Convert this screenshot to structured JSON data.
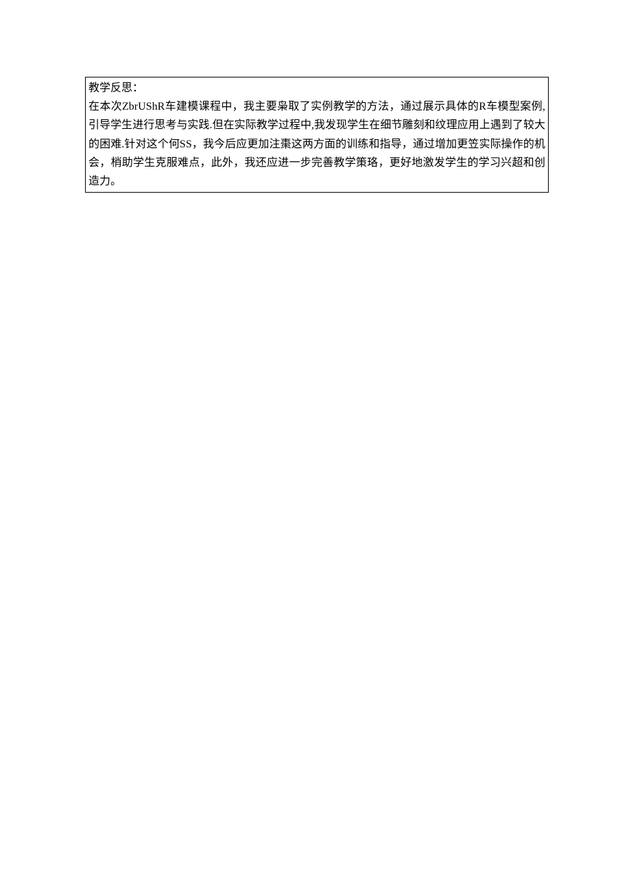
{
  "document": {
    "heading": "教学反思：",
    "body": "在本次ZbrUShR车建模课程中，我主要枭取了实例教学的方法，通过展示具体的R车模型案例,引导学生进行思考与实践.但在实际教学过程中,我发现学生在细节雕刻和纹理应用上遇到了较大的困难.针对这个何SS，我今后应更加注棗这两方面的训练和指导，通过增加更笠实际操作的机会，梢助学生克服难点，此外，我还应进一步完善教学策珞，更好地激发学生的学习兴超和创造力。"
  }
}
